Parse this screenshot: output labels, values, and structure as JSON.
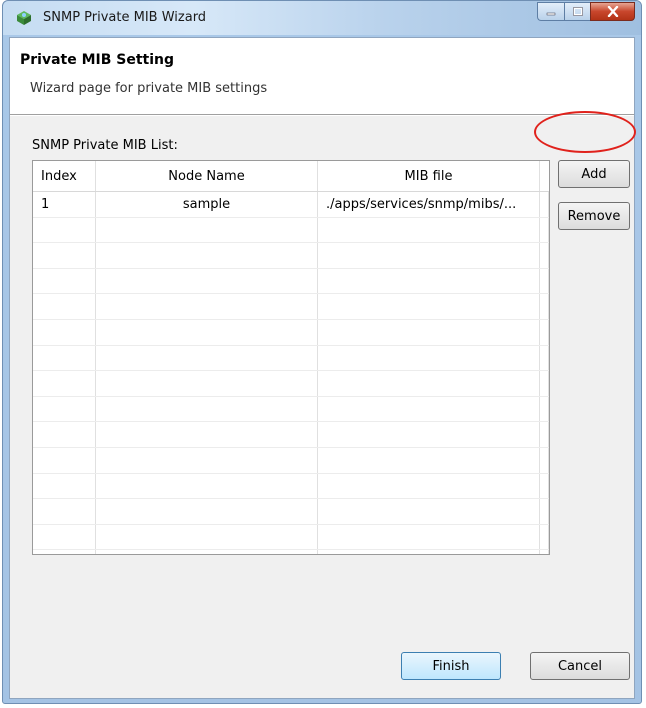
{
  "window": {
    "title": "SNMP Private MIB Wizard"
  },
  "banner": {
    "title": "Private MIB Setting",
    "description": "Wizard page for private MIB settings"
  },
  "list": {
    "label": "SNMP Private MIB List:",
    "columns": [
      "Index",
      "Node Name",
      "MIB file"
    ],
    "rows": [
      {
        "index": "1",
        "node_name": "sample",
        "mib_file": "./apps/services/snmp/mibs/..."
      }
    ]
  },
  "buttons": {
    "add": "Add",
    "remove": "Remove",
    "finish": "Finish",
    "cancel": "Cancel"
  },
  "colors": {
    "highlight": "#e0221c",
    "accent": "#3c7fb1"
  }
}
